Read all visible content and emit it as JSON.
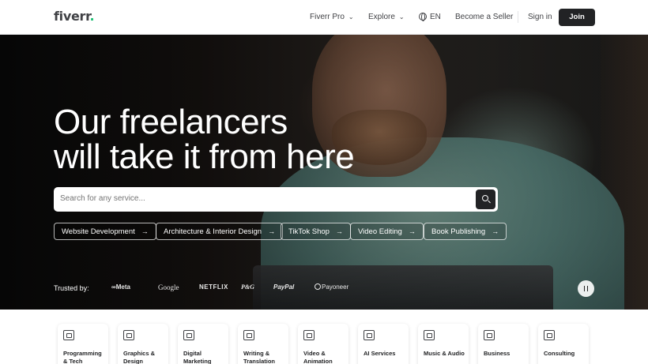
{
  "header": {
    "logo": "fiverr",
    "logo_dot": ".",
    "fiverr_pro": "Fiverr Pro",
    "explore": "Explore",
    "language": "EN",
    "become_seller": "Become a Seller",
    "sign_in": "Sign in",
    "join": "Join"
  },
  "hero": {
    "title_line1": "Our freelancers",
    "title_line2": "will take it from here",
    "search_placeholder": "Search for any service..."
  },
  "chips": [
    {
      "label": "Website Development",
      "arrow": "→"
    },
    {
      "label": "Architecture & Interior Design",
      "arrow": "→"
    },
    {
      "label": "TikTok Shop",
      "arrow": "→"
    },
    {
      "label": "Video Editing",
      "arrow": "→"
    },
    {
      "label": "Book Publishing",
      "arrow": "→"
    }
  ],
  "trusted": {
    "label": "Trusted by:",
    "brands": [
      "∞Meta",
      "Google",
      "NETFLIX",
      "P&G",
      "PayPal",
      "Payoneer"
    ]
  },
  "categories": [
    {
      "label": "Programming & Tech",
      "icon": "monitor-icon"
    },
    {
      "label": "Graphics & Design",
      "icon": "design-icon"
    },
    {
      "label": "Digital Marketing",
      "icon": "marketing-icon"
    },
    {
      "label": "Writing & Translation",
      "icon": "writing-icon"
    },
    {
      "label": "Video & Animation",
      "icon": "video-icon"
    },
    {
      "label": "AI Services",
      "icon": "ai-icon"
    },
    {
      "label": "Music & Audio",
      "icon": "music-icon"
    },
    {
      "label": "Business",
      "icon": "business-icon"
    },
    {
      "label": "Consulting",
      "icon": "consulting-icon"
    }
  ],
  "colors": {
    "brand_green": "#1dbf73",
    "dark": "#222325",
    "text": "#404145"
  }
}
